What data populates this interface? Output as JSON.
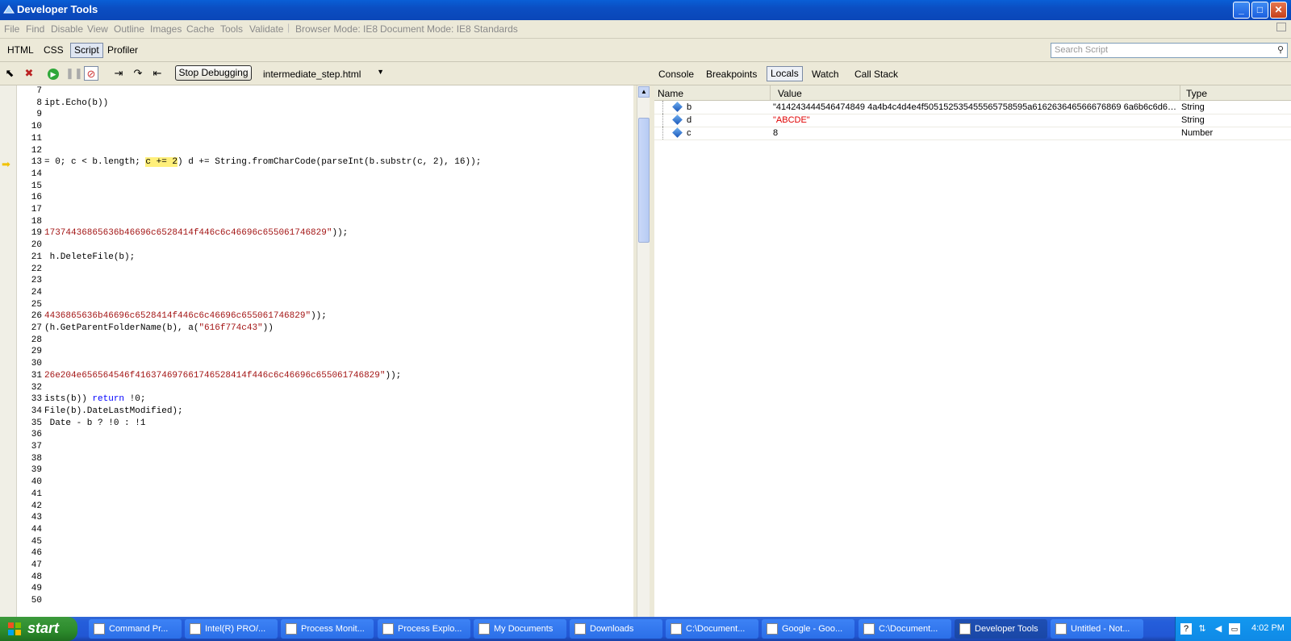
{
  "window": {
    "title": "Developer Tools"
  },
  "menu": [
    "File",
    "Find",
    "Disable",
    "View",
    "Outline",
    "Images",
    "Cache",
    "Tools",
    "Validate"
  ],
  "modes": {
    "browser_mode": "Browser Mode: IE8",
    "document_mode": "Document Mode: IE8 Standards"
  },
  "main_tabs": [
    "HTML",
    "CSS",
    "Script",
    "Profiler"
  ],
  "active_main_tab": "Script",
  "search": {
    "placeholder": "Search Script"
  },
  "toolbar": {
    "stop_debugging_label": "Stop Debugging",
    "file_name": "intermediate_step.html"
  },
  "right_tabs": [
    "Console",
    "Breakpoints",
    "Locals",
    "Watch",
    "Call Stack"
  ],
  "active_right_tab": "Locals",
  "code_lines": [
    {
      "n": "7",
      "segs": []
    },
    {
      "n": "8",
      "segs": [
        {
          "t": "ipt.Echo(b))"
        }
      ]
    },
    {
      "n": "9",
      "segs": []
    },
    {
      "n": "10",
      "segs": []
    },
    {
      "n": "11",
      "segs": []
    },
    {
      "n": "12",
      "segs": []
    },
    {
      "n": "13",
      "segs": [
        {
          "t": "= 0; c < b.length; "
        },
        {
          "t": "c += 2",
          "c": "hl"
        },
        {
          "t": ") d += String.fromCharCode(parseInt(b.substr(c, 2), 16));"
        }
      ]
    },
    {
      "n": "14",
      "segs": []
    },
    {
      "n": "15",
      "segs": []
    },
    {
      "n": "16",
      "segs": []
    },
    {
      "n": "17",
      "segs": []
    },
    {
      "n": "18",
      "segs": []
    },
    {
      "n": "19",
      "segs": [
        {
          "t": "17374436865636b46696c6528414f446c6c46696c655061746829\"",
          "c": "str"
        },
        {
          "t": "));"
        }
      ]
    },
    {
      "n": "20",
      "segs": []
    },
    {
      "n": "21",
      "segs": [
        {
          "t": " h.DeleteFile(b);"
        }
      ]
    },
    {
      "n": "22",
      "segs": []
    },
    {
      "n": "23",
      "segs": []
    },
    {
      "n": "24",
      "segs": []
    },
    {
      "n": "25",
      "segs": []
    },
    {
      "n": "26",
      "segs": [
        {
          "t": "4436865636b46696c6528414f446c6c46696c655061746829\"",
          "c": "str"
        },
        {
          "t": "));"
        }
      ]
    },
    {
      "n": "27",
      "segs": [
        {
          "t": "(h.GetParentFolderName(b), a("
        },
        {
          "t": "\"616f774c43\"",
          "c": "str"
        },
        {
          "t": "))"
        }
      ]
    },
    {
      "n": "28",
      "segs": []
    },
    {
      "n": "29",
      "segs": []
    },
    {
      "n": "30",
      "segs": []
    },
    {
      "n": "31",
      "segs": [
        {
          "t": "26e204e656564546f416374697661746528414f446c6c46696c655061746829\"",
          "c": "str"
        },
        {
          "t": "));"
        }
      ]
    },
    {
      "n": "32",
      "segs": []
    },
    {
      "n": "33",
      "segs": [
        {
          "t": "ists(b)) "
        },
        {
          "t": "return",
          "c": "kw"
        },
        {
          "t": " !0;"
        }
      ]
    },
    {
      "n": "34",
      "segs": [
        {
          "t": "File(b).DateLastModified);"
        }
      ]
    },
    {
      "n": "35",
      "segs": [
        {
          "t": " Date - b ? !0 : !1"
        }
      ]
    },
    {
      "n": "36",
      "segs": []
    },
    {
      "n": "37",
      "segs": []
    },
    {
      "n": "38",
      "segs": []
    },
    {
      "n": "39",
      "segs": []
    },
    {
      "n": "40",
      "segs": []
    },
    {
      "n": "41",
      "segs": []
    },
    {
      "n": "42",
      "segs": []
    },
    {
      "n": "43",
      "segs": []
    },
    {
      "n": "44",
      "segs": []
    },
    {
      "n": "45",
      "segs": []
    },
    {
      "n": "46",
      "segs": []
    },
    {
      "n": "47",
      "segs": []
    },
    {
      "n": "48",
      "segs": []
    },
    {
      "n": "49",
      "segs": []
    },
    {
      "n": "50",
      "segs": []
    }
  ],
  "current_line": "13",
  "locals": {
    "columns": [
      "Name",
      "Value",
      "Type"
    ],
    "rows": [
      {
        "name": "b",
        "value": "\"414243444546474849 4a4b4c4d4e4f505152535455565758595a616263646566676869 6a6b6c6d6e6f...",
        "type": "String"
      },
      {
        "name": "d",
        "value": "\"ABCDE\"",
        "type": "String",
        "value_color": "#e00000"
      },
      {
        "name": "c",
        "value": "8",
        "type": "Number"
      }
    ]
  },
  "taskbar": {
    "start_label": "start",
    "items": [
      {
        "label": "Command Pr...",
        "icon": "cmd-icon"
      },
      {
        "label": "Intel(R) PRO/...",
        "icon": "network-icon"
      },
      {
        "label": "Process Monit...",
        "icon": "process-monitor-icon"
      },
      {
        "label": "Process Explo...",
        "icon": "process-explorer-icon"
      },
      {
        "label": "My Documents",
        "icon": "folder-icon"
      },
      {
        "label": "Downloads",
        "icon": "folder-icon"
      },
      {
        "label": "C:\\Document...",
        "icon": "notepad-icon"
      },
      {
        "label": "Google - Goo...",
        "icon": "chrome-icon"
      },
      {
        "label": "C:\\Document...",
        "icon": "ie-icon"
      },
      {
        "label": "Developer Tools",
        "icon": "devtools-icon",
        "active": true
      },
      {
        "label": "Untitled - Not...",
        "icon": "notepad-icon"
      }
    ],
    "clock": "4:02 PM"
  }
}
